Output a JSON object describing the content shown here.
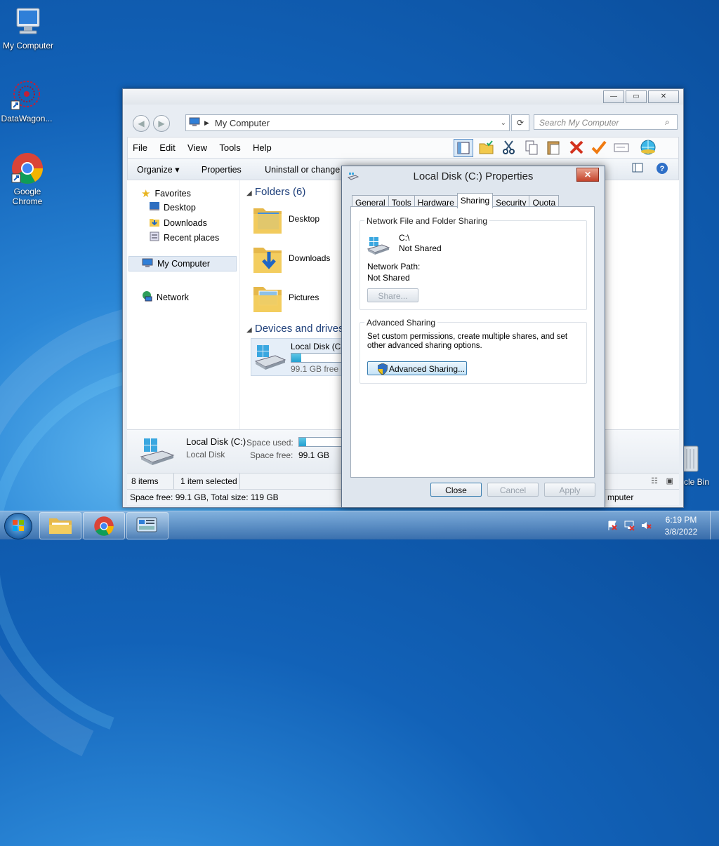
{
  "desktop": {
    "icons": [
      {
        "label": "My Computer"
      },
      {
        "label": "DataWagon..."
      },
      {
        "label": "Google Chrome"
      },
      {
        "label": "cle Bin"
      }
    ]
  },
  "explorer": {
    "address": "My Computer",
    "search_placeholder": "Search My Computer",
    "menu": [
      "File",
      "Edit",
      "View",
      "Tools",
      "Help"
    ],
    "toolbar": {
      "organize": "Organize",
      "properties": "Properties",
      "uninstall": "Uninstall or change a"
    },
    "nav": {
      "favorites": "Favorites",
      "desktop": "Desktop",
      "downloads": "Downloads",
      "recent": "Recent places",
      "computer": "My Computer",
      "network": "Network"
    },
    "folders_header": "Folders (6)",
    "folders": [
      "Desktop",
      "Downloads",
      "Pictures"
    ],
    "devices_header": "Devices and drives",
    "drive": {
      "name": "Local Disk (C:",
      "free": "99.1 GB free o",
      "used_fraction": 0.17
    },
    "details": {
      "name": "Local Disk (C:)",
      "type": "Local Disk",
      "space_used_label": "Space used:",
      "space_free_label": "Space free:",
      "space_free_value": "99.1 GB",
      "used_fraction": 0.17
    },
    "status": {
      "items": "8 items",
      "selected": "1 item selected",
      "space": "Space free: 99.1 GB, Total size: 119 GB",
      "right": "mputer"
    }
  },
  "dialog": {
    "title": "Local Disk (C:) Properties",
    "tabs": [
      "General",
      "Tools",
      "Hardware",
      "Sharing",
      "Security",
      "Quota"
    ],
    "active_tab": "Sharing",
    "network_group": {
      "title": "Network File and Folder Sharing",
      "drive": "C:\\",
      "status": "Not Shared",
      "path_label": "Network Path:",
      "path_value": "Not Shared",
      "share_button": "Share..."
    },
    "advanced_group": {
      "title": "Advanced Sharing",
      "description": "Set custom permissions, create multiple shares, and set other advanced sharing options.",
      "button": "Advanced Sharing..."
    },
    "buttons": {
      "close": "Close",
      "cancel": "Cancel",
      "apply": "Apply"
    }
  },
  "taskbar": {
    "time": "6:19 PM",
    "date": "3/8/2022"
  }
}
